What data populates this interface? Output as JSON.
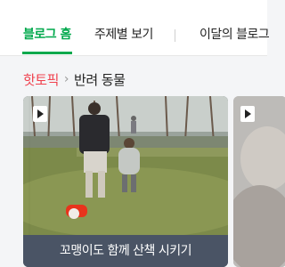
{
  "tabs": [
    {
      "label": "블로그 홈",
      "active": true
    },
    {
      "label": "주제별 보기",
      "active": false
    },
    {
      "label": "이달의 블로그",
      "active": false
    }
  ],
  "breadcrumb": {
    "hot": "핫토픽",
    "separator": "›",
    "category": "반려 동물"
  },
  "cards": [
    {
      "caption": "꼬맹이도 함께 산책 시키기",
      "icon": "play-icon"
    },
    {
      "caption": "",
      "icon": "play-icon"
    }
  ],
  "colors": {
    "accent": "#03a94d",
    "hot": "#f0414e",
    "caption_bg": "#4a5465"
  }
}
